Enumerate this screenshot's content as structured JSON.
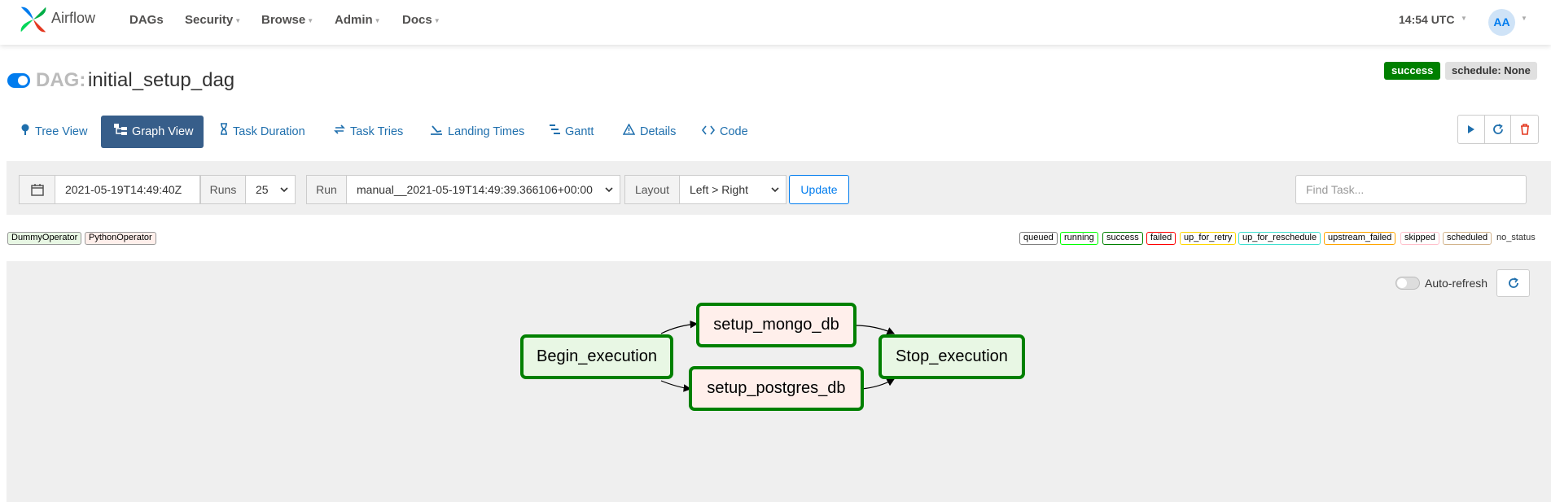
{
  "app": {
    "brand": "Airflow"
  },
  "nav": {
    "items": [
      {
        "label": "DAGs",
        "dropdown": false
      },
      {
        "label": "Security",
        "dropdown": true
      },
      {
        "label": "Browse",
        "dropdown": true
      },
      {
        "label": "Admin",
        "dropdown": true
      },
      {
        "label": "Docs",
        "dropdown": true
      }
    ],
    "clock": "14:54 UTC",
    "avatar": "AA"
  },
  "dag": {
    "prefix": "DAG:",
    "id": "initial_setup_dag",
    "paused": false,
    "status_badge": "success",
    "schedule_badge": "schedule: None"
  },
  "tabs": [
    {
      "label": "Tree View",
      "icon": "tree-icon",
      "active": false
    },
    {
      "label": "Graph View",
      "icon": "graph-icon",
      "active": true
    },
    {
      "label": "Task Duration",
      "icon": "hourglass-icon",
      "active": false
    },
    {
      "label": "Task Tries",
      "icon": "retry-icon",
      "active": false
    },
    {
      "label": "Landing Times",
      "icon": "landing-icon",
      "active": false
    },
    {
      "label": "Gantt",
      "icon": "gantt-icon",
      "active": false
    },
    {
      "label": "Details",
      "icon": "warning-icon",
      "active": false
    },
    {
      "label": "Code",
      "icon": "code-icon",
      "active": false
    }
  ],
  "actions": [
    "play-icon",
    "refresh-icon",
    "trash-icon"
  ],
  "filters": {
    "base_date": "2021-05-19T14:49:40Z",
    "runs_label": "Runs",
    "runs_value": "25",
    "run_label": "Run",
    "run_value": "manual__2021-05-19T14:49:39.366106+00:00",
    "layout_label": "Layout",
    "layout_value": "Left > Right",
    "update_label": "Update",
    "find_placeholder": "Find Task..."
  },
  "operators": [
    {
      "label": "DummyOperator",
      "bg": "#e8f7e4"
    },
    {
      "label": "PythonOperator",
      "bg": "#ffefeb"
    }
  ],
  "states": [
    {
      "label": "queued",
      "color": "#808080"
    },
    {
      "label": "running",
      "color": "#00ff00"
    },
    {
      "label": "success",
      "color": "#008000"
    },
    {
      "label": "failed",
      "color": "#ff0000"
    },
    {
      "label": "up_for_retry",
      "color": "#ffd700"
    },
    {
      "label": "up_for_reschedule",
      "color": "#40e0d0"
    },
    {
      "label": "upstream_failed",
      "color": "#ffa500"
    },
    {
      "label": "skipped",
      "color": "#ffc0cb"
    },
    {
      "label": "scheduled",
      "color": "#d2b48c"
    }
  ],
  "no_status": "no_status",
  "graph": {
    "auto_refresh_label": "Auto-refresh",
    "auto_refresh_on": false,
    "nodes": [
      {
        "id": "Begin_execution",
        "operator": "DummyOperator",
        "state": "success"
      },
      {
        "id": "setup_mongo_db",
        "operator": "PythonOperator",
        "state": "success"
      },
      {
        "id": "setup_postgres_db",
        "operator": "PythonOperator",
        "state": "success"
      },
      {
        "id": "Stop_execution",
        "operator": "DummyOperator",
        "state": "success"
      }
    ],
    "edges": [
      [
        "Begin_execution",
        "setup_mongo_db"
      ],
      [
        "Begin_execution",
        "setup_postgres_db"
      ],
      [
        "setup_mongo_db",
        "Stop_execution"
      ],
      [
        "setup_postgres_db",
        "Stop_execution"
      ]
    ]
  }
}
